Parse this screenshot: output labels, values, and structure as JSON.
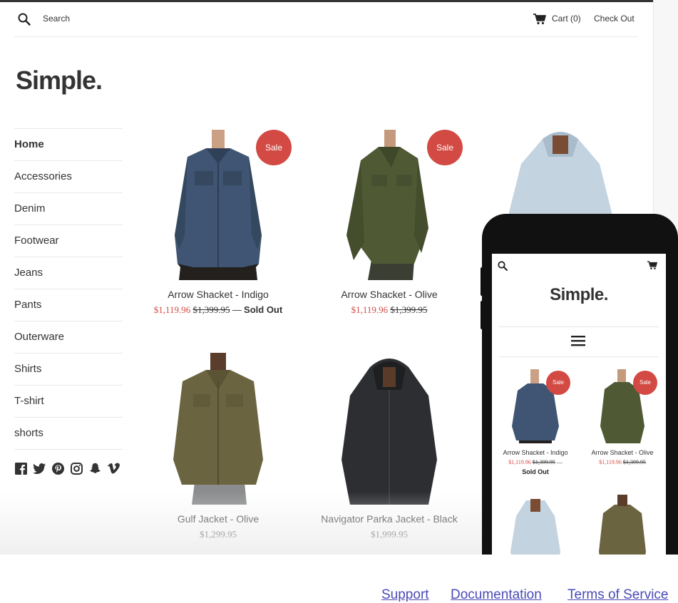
{
  "header": {
    "search_label": "Search",
    "cart_label": "Cart (0)",
    "checkout_label": "Check Out"
  },
  "logo": "Simple.",
  "nav": {
    "items": [
      {
        "label": "Home",
        "active": true
      },
      {
        "label": "Accessories"
      },
      {
        "label": "Denim"
      },
      {
        "label": "Footwear"
      },
      {
        "label": "Jeans"
      },
      {
        "label": "Pants"
      },
      {
        "label": "Outerware"
      },
      {
        "label": "Shirts"
      },
      {
        "label": "T-shirt"
      },
      {
        "label": "shorts"
      }
    ]
  },
  "social": [
    "facebook-icon",
    "twitter-icon",
    "pinterest-icon",
    "instagram-icon",
    "snapchat-icon",
    "vimeo-icon"
  ],
  "badge": "Sale",
  "dash": "—",
  "products": [
    {
      "title": "Arrow Shacket - Indigo",
      "sale_price": "$1,119.96",
      "old_price": "$1,399.95",
      "sold_out": "Sold Out",
      "color": "#3f5573"
    },
    {
      "title": "Arrow Shacket - Olive",
      "sale_price": "$1,119.96",
      "old_price": "$1,399.95",
      "color": "#4f5a35"
    },
    {
      "title": "Gulf Jacket - Olive",
      "price": "$1,299.95",
      "color": "#6b6440"
    },
    {
      "title": "Navigator Parka Jacket - Black",
      "price": "$1,999.95",
      "color": "#2c2e31"
    }
  ],
  "mobile": {
    "logo": "Simple.",
    "products": [
      {
        "title": "Arrow Shacket - Indigo",
        "sale_price": "$1,119.96",
        "old_price": "$1,399.95",
        "sold_out": "Sold Out"
      },
      {
        "title": "Arrow Shacket - Olive",
        "sale_price": "$1,119.96",
        "old_price": "$1,399.95"
      }
    ]
  },
  "footer": {
    "links": [
      "Support",
      "Documentation",
      "Terms of Service"
    ]
  },
  "colors": {
    "sale": "#d24a43",
    "link": "#4a4ab8"
  }
}
